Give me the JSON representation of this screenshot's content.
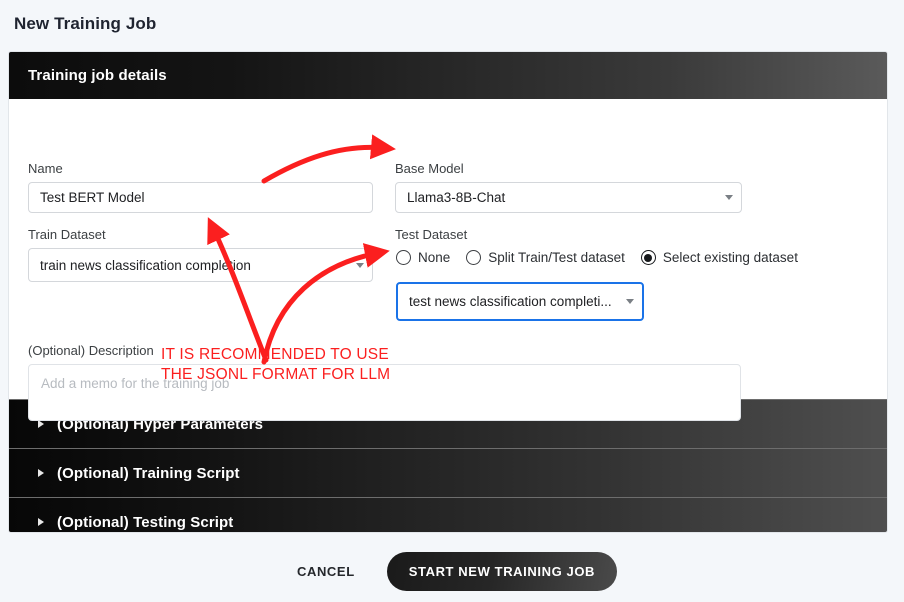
{
  "page": {
    "title": "New Training Job"
  },
  "card": {
    "header_title": "Training job details",
    "fields": {
      "name_label": "Name",
      "name_value": "Test BERT Model",
      "base_model_label": "Base Model",
      "base_model_value": "Llama3-8B-Chat",
      "train_dataset_label": "Train Dataset",
      "train_dataset_value": "train news classification completion",
      "test_dataset_label": "Test Dataset",
      "test_dataset_value": "test news classification completi...",
      "description_label": "(Optional) Description",
      "description_value": "",
      "description_placeholder": "Add a memo for the training job"
    },
    "test_dataset_options": [
      {
        "label": "None",
        "selected": false
      },
      {
        "label": "Split Train/Test dataset",
        "selected": false
      },
      {
        "label": "Select existing dataset",
        "selected": true
      }
    ]
  },
  "accordions": [
    {
      "label": "(Optional) Hyper Parameters"
    },
    {
      "label": "(Optional) Training Script"
    },
    {
      "label": "(Optional) Testing Script"
    }
  ],
  "footer": {
    "cancel_label": "CANCEL",
    "submit_label": "START NEW TRAINING JOB"
  },
  "annotations": {
    "color": "#fb1f1f",
    "line1": "IT IS RECOMMENDED TO USE",
    "line2": "THE JSONL FORMAT FOR LLM"
  }
}
